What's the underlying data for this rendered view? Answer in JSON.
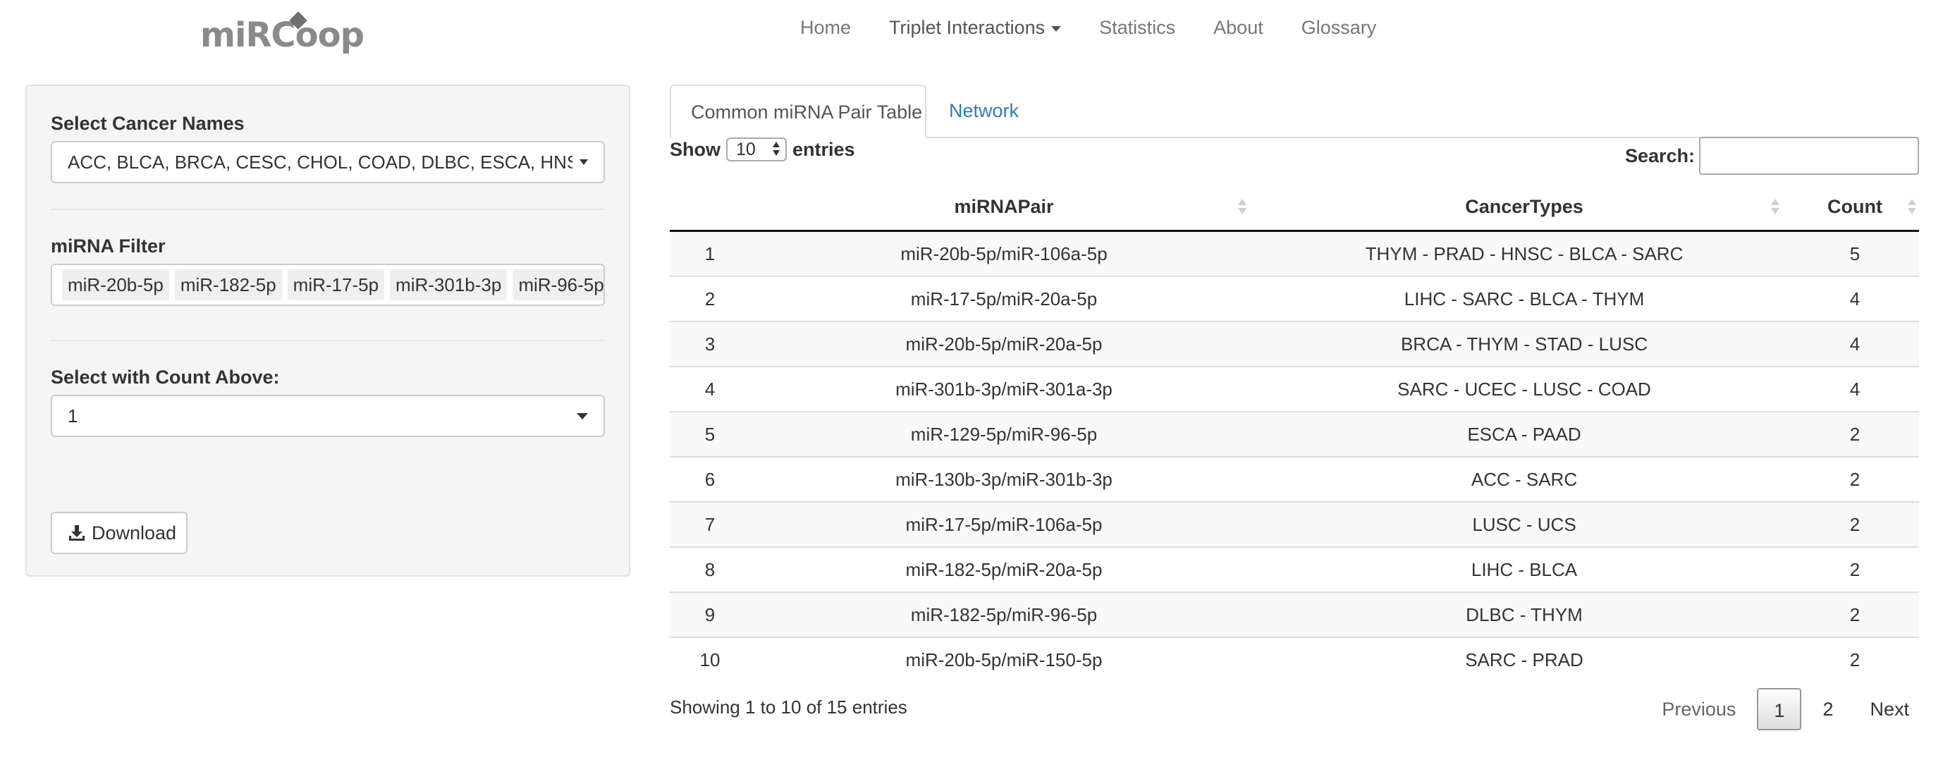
{
  "nav": {
    "logo": "miRCoop",
    "items": [
      "Home",
      "Triplet Interactions",
      "Statistics",
      "About",
      "Glossary"
    ]
  },
  "sidebar": {
    "cancer_label": "Select Cancer Names",
    "cancer_value": "ACC, BLCA, BRCA, CESC, CHOL, COAD, DLBC, ESCA, HNSC,",
    "mirna_label": "miRNA Filter",
    "mirna_tags": [
      "miR-20b-5p",
      "miR-182-5p",
      "miR-17-5p",
      "miR-301b-3p",
      "miR-96-5p"
    ],
    "count_label": "Select with Count Above:",
    "count_value": "1",
    "download_label": "Download"
  },
  "tabs": [
    "Common miRNA Pair Table",
    "Network"
  ],
  "table_controls": {
    "show": "Show",
    "length_value": "10",
    "entries": "entries",
    "search_label": "Search:",
    "search_value": ""
  },
  "table": {
    "columns": [
      "",
      "miRNAPair",
      "CancerTypes",
      "Count"
    ],
    "rows": [
      [
        "1",
        "miR-20b-5p/miR-106a-5p",
        "THYM - PRAD - HNSC - BLCA - SARC",
        "5"
      ],
      [
        "2",
        "miR-17-5p/miR-20a-5p",
        "LIHC - SARC - BLCA - THYM",
        "4"
      ],
      [
        "3",
        "miR-20b-5p/miR-20a-5p",
        "BRCA - THYM - STAD - LUSC",
        "4"
      ],
      [
        "4",
        "miR-301b-3p/miR-301a-3p",
        "SARC - UCEC - LUSC - COAD",
        "4"
      ],
      [
        "5",
        "miR-129-5p/miR-96-5p",
        "ESCA - PAAD",
        "2"
      ],
      [
        "6",
        "miR-130b-3p/miR-301b-3p",
        "ACC - SARC",
        "2"
      ],
      [
        "7",
        "miR-17-5p/miR-106a-5p",
        "LUSC - UCS",
        "2"
      ],
      [
        "8",
        "miR-182-5p/miR-20a-5p",
        "LIHC - BLCA",
        "2"
      ],
      [
        "9",
        "miR-182-5p/miR-96-5p",
        "DLBC - THYM",
        "2"
      ],
      [
        "10",
        "miR-20b-5p/miR-150-5p",
        "SARC - PRAD",
        "2"
      ]
    ]
  },
  "footer": {
    "info": "Showing 1 to 10 of 15 entries",
    "previous": "Previous",
    "pages": [
      "1",
      "2"
    ],
    "next": "Next"
  }
}
